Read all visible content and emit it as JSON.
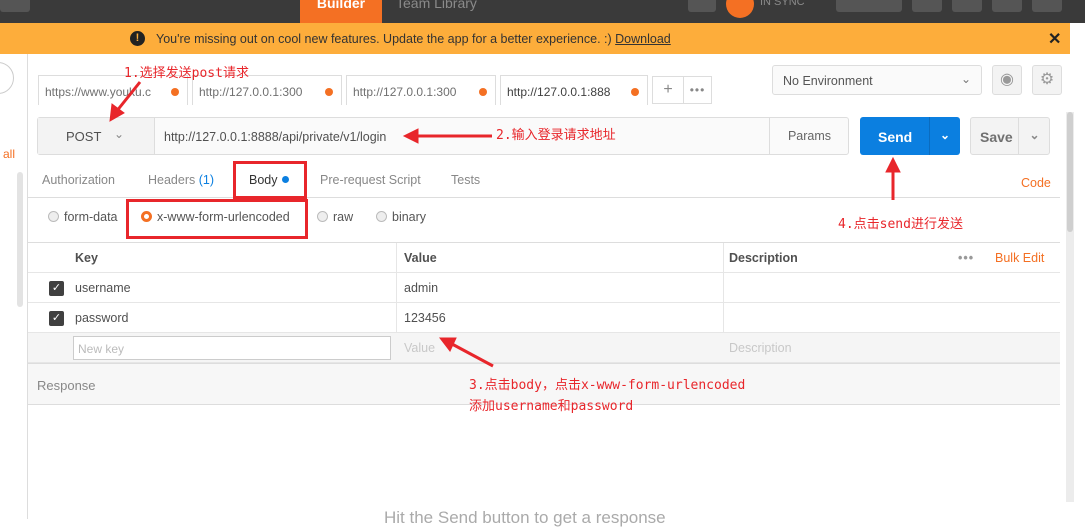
{
  "top_tabs": {
    "builder": "Builder",
    "team_library": "Team Library",
    "sync": "IN SYNC"
  },
  "banner": {
    "message": "You're missing out on cool new features. Update the app for a better experience. :) ",
    "download": "Download",
    "close": "✕"
  },
  "sidebar": {
    "all": "all"
  },
  "request_tabs": [
    {
      "label": "https://www.youku.c"
    },
    {
      "label": "http://127.0.0.1:300"
    },
    {
      "label": "http://127.0.0.1:300"
    },
    {
      "label": "http://127.0.0.1:888"
    }
  ],
  "tab_controls": {
    "add": "+",
    "more": "•••"
  },
  "environment": {
    "selected": "No Environment"
  },
  "request": {
    "method": "POST",
    "url": "http://127.0.0.1:8888/api/private/v1/login",
    "params": "Params",
    "send": "Send",
    "save": "Save"
  },
  "subtabs": {
    "authorization": "Authorization",
    "headers": "Headers",
    "headers_count": "(1)",
    "body": "Body",
    "prerequest": "Pre-request Script",
    "tests": "Tests",
    "code": "Code"
  },
  "body_modes": {
    "form_data": "form-data",
    "urlencoded": "x-www-form-urlencoded",
    "raw": "raw",
    "binary": "binary",
    "selected": "x-www-form-urlencoded"
  },
  "kv_table": {
    "headers": {
      "key": "Key",
      "value": "Value",
      "description": "Description",
      "more": "•••",
      "bulk_edit": "Bulk Edit"
    },
    "rows": [
      {
        "key": "username",
        "value": "admin",
        "checked": true
      },
      {
        "key": "password",
        "value": "123456",
        "checked": true
      }
    ],
    "placeholders": {
      "key": "New key",
      "value": "Value",
      "description": "Description"
    }
  },
  "response": {
    "label": "Response",
    "hint": "Hit the Send button to get a response"
  },
  "annotations": {
    "a1": "1.选择发送post请求",
    "a2": "2.输入登录请求地址",
    "a3_line1": "3.点击body，点击x-www-form-urlencoded",
    "a3_line2": "添加username和password",
    "a4": "4.点击send进行发送"
  },
  "colors": {
    "accent": "#f47023",
    "send_blue": "#0b7fe0",
    "banner": "#fdad3b",
    "annotation_red": "#e8262b"
  }
}
